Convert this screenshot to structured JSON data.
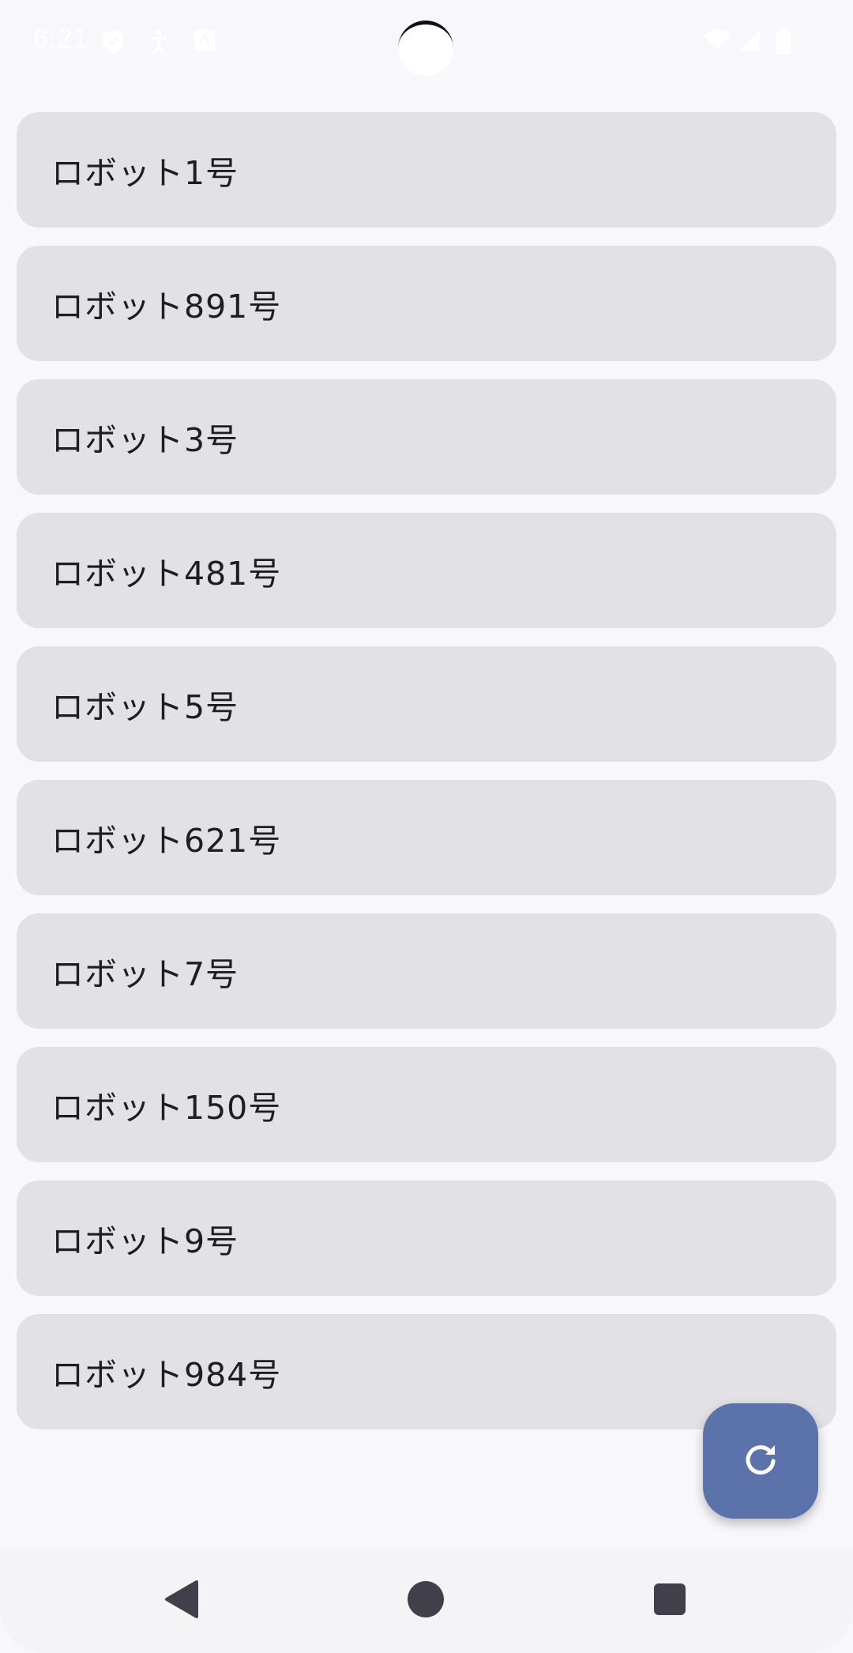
{
  "status_bar": {
    "time": "6:21",
    "icons": [
      "shield-icon",
      "accessibility-icon",
      "keyboard-icon",
      "wifi-icon",
      "signal-icon",
      "battery-icon"
    ],
    "text_color": "#ffffff"
  },
  "robots": [
    {
      "label": "ロボット1号"
    },
    {
      "label": "ロボット891号"
    },
    {
      "label": "ロボット3号"
    },
    {
      "label": "ロボット481号"
    },
    {
      "label": "ロボット5号"
    },
    {
      "label": "ロボット621号"
    },
    {
      "label": "ロボット7号"
    },
    {
      "label": "ロボット150号"
    },
    {
      "label": "ロボット9号"
    },
    {
      "label": "ロボット984号"
    }
  ],
  "fab": {
    "icon": "refresh-icon",
    "color": "#5c72aa"
  },
  "nav_bar": {
    "buttons": [
      "back-icon",
      "home-icon",
      "recents-icon"
    ]
  },
  "colors": {
    "background": "#f8f7fc",
    "card": "#e1e1e6",
    "text": "#1d1d22"
  }
}
